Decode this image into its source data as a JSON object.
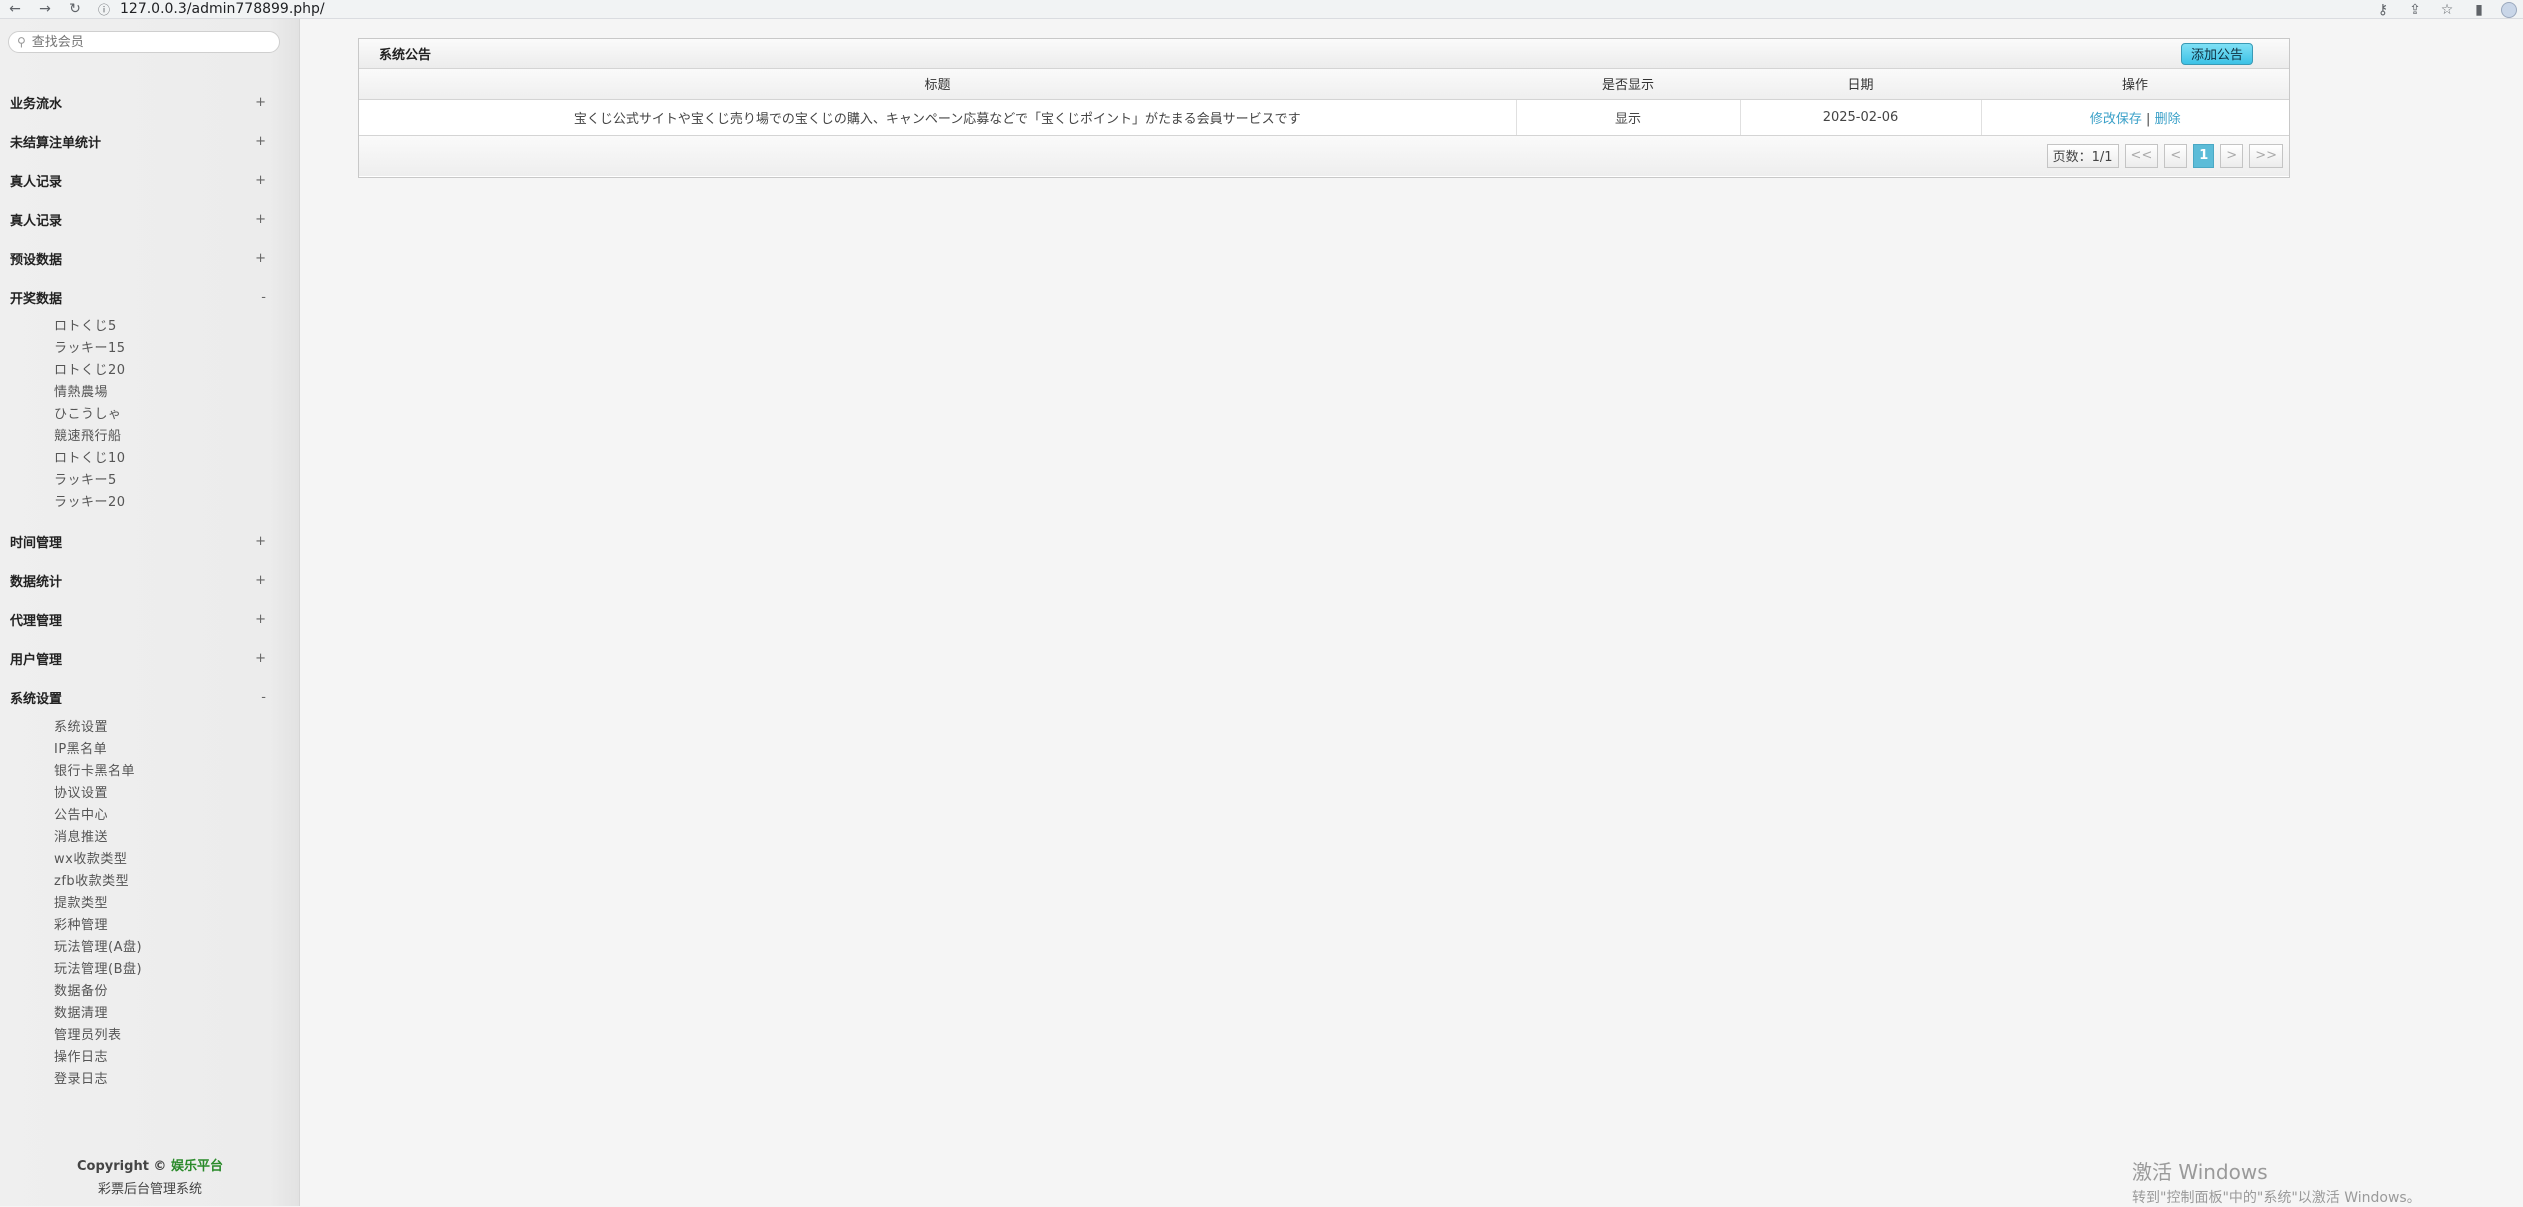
{
  "browser": {
    "url": "127.0.0.3/admin778899.php/"
  },
  "sidebar": {
    "search_placeholder": "查找会员",
    "groups": [
      {
        "label": "业务流水",
        "toggle": "+"
      },
      {
        "label": "未结算注单统计",
        "toggle": "+"
      },
      {
        "label": "真人记录",
        "toggle": "+"
      },
      {
        "label": "真人记录",
        "toggle": "+"
      },
      {
        "label": "预设数据",
        "toggle": "+"
      },
      {
        "label": "开奖数据",
        "toggle": "-"
      },
      {
        "label": "时间管理",
        "toggle": "+"
      },
      {
        "label": "数据统计",
        "toggle": "+"
      },
      {
        "label": "代理管理",
        "toggle": "+"
      },
      {
        "label": "用户管理",
        "toggle": "+"
      },
      {
        "label": "系统设置",
        "toggle": "-"
      }
    ],
    "lottery_items": [
      "ロトくじ5",
      "ラッキー15",
      "ロトくじ20",
      "情熱農場",
      "ひこうしゃ",
      "競速飛行船",
      "ロトくじ10",
      "ラッキー5",
      "ラッキー20"
    ],
    "system_items": [
      "系统设置",
      "IP黑名单",
      "银行卡黑名单",
      "协议设置",
      "公告中心",
      "消息推送",
      "wx收款类型",
      "zfb收款类型",
      "提款类型",
      "彩种管理",
      "玩法管理(A盘)",
      "玩法管理(B盘)",
      "数据备份",
      "数据清理",
      "管理员列表",
      "操作日志",
      "登录日志"
    ],
    "copyright": {
      "prefix": "Copyright ©",
      "brand": "娱乐平台",
      "subtitle": "彩票后台管理系统"
    }
  },
  "panel": {
    "title": "系统公告",
    "add_button": "添加公告",
    "columns": [
      "标题",
      "是否显示",
      "日期",
      "操作"
    ],
    "rows": [
      {
        "title": "宝くじ公式サイトや宝くじ売り場での宝くじの購入、キャンペーン応募などで「宝くじポイント」がたまる会員サービスです",
        "visible": "显示",
        "date": "2025-02-06",
        "edit": "修改保存",
        "separator": "|",
        "delete": "删除"
      }
    ],
    "pager": {
      "info": "页数：1/1",
      "first": "<<",
      "prev": "<",
      "current": "1",
      "next": ">",
      "last": ">>"
    }
  },
  "watermark": {
    "line1": "激活 Windows",
    "line2": "转到\"控制面板\"中的\"系统\"以激活 Windows。"
  }
}
